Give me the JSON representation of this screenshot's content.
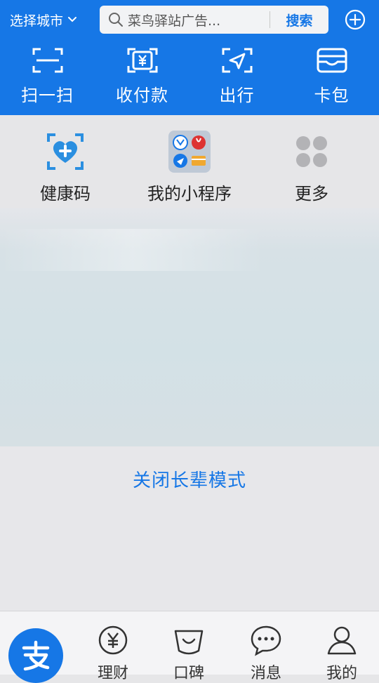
{
  "header": {
    "city_label": "选择城市",
    "search_placeholder": "菜鸟驿站广告...",
    "search_button": "搜索",
    "tools": [
      {
        "label": "扫一扫",
        "icon": "scan-icon"
      },
      {
        "label": "收付款",
        "icon": "payment-code-icon"
      },
      {
        "label": "出行",
        "icon": "travel-icon"
      },
      {
        "label": "卡包",
        "icon": "card-wallet-icon"
      }
    ]
  },
  "shortcuts": [
    {
      "label": "健康码",
      "icon": "health-code-icon"
    },
    {
      "label": "我的小程序",
      "icon": "mini-programs-icon"
    },
    {
      "label": "更多",
      "icon": "more-grid-icon"
    }
  ],
  "main": {
    "close_elder_mode": "关闭长辈模式"
  },
  "bottom_nav": {
    "items": [
      {
        "label": "",
        "icon": "alipay-home-icon"
      },
      {
        "label": "理财",
        "icon": "finance-icon"
      },
      {
        "label": "口碑",
        "icon": "koubei-icon"
      },
      {
        "label": "消息",
        "icon": "message-icon"
      },
      {
        "label": "我的",
        "icon": "profile-icon"
      }
    ]
  },
  "colors": {
    "brand_blue": "#1677e6",
    "page_bg": "#e6e6e8",
    "health_cyan": "#2b8fe0"
  }
}
